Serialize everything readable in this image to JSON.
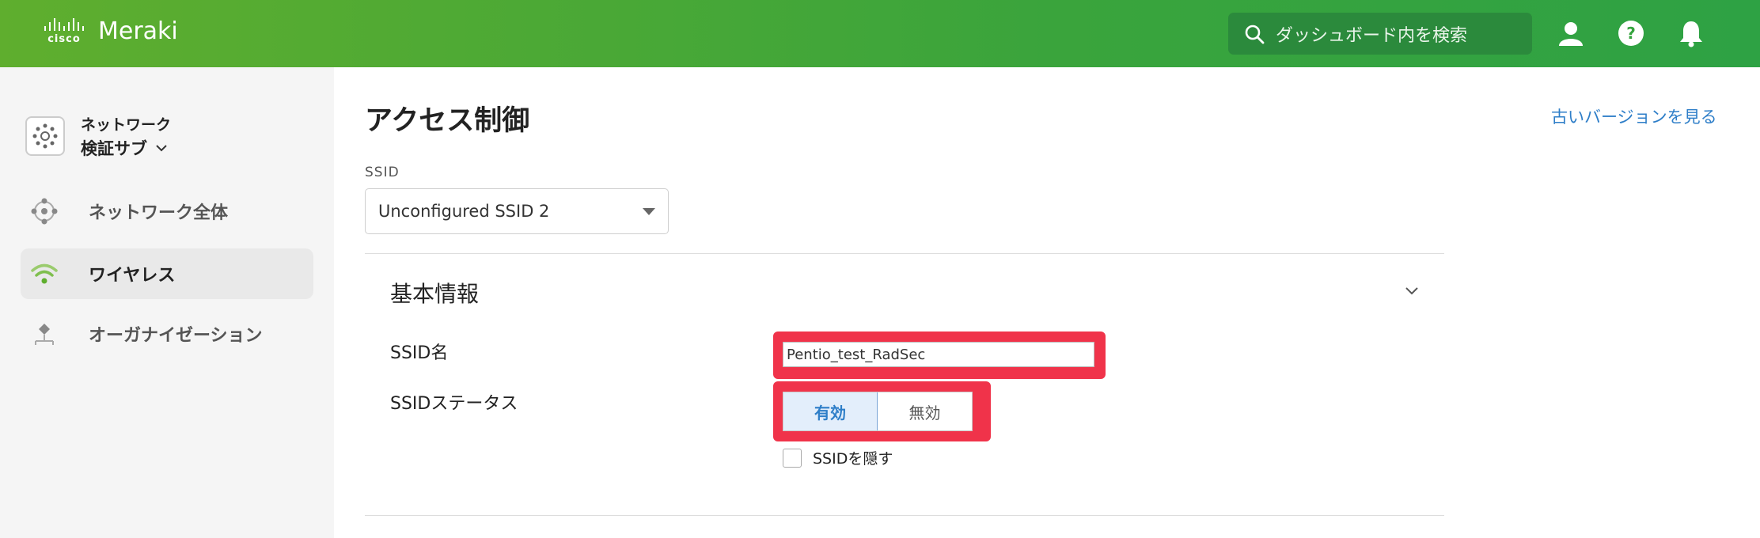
{
  "header": {
    "brand_small": "cisco",
    "brand": "Meraki",
    "search_placeholder": "ダッシュボード内を検索",
    "icons": [
      "user-icon",
      "help-icon",
      "bell-icon"
    ]
  },
  "sidebar": {
    "network_heading": "ネットワーク",
    "network_name": "検証サブ",
    "items": [
      {
        "label": "ネットワーク全体",
        "icon": "network-wide-icon",
        "active": false
      },
      {
        "label": "ワイヤレス",
        "icon": "wifi-icon",
        "active": true
      },
      {
        "label": "オーガナイゼーション",
        "icon": "organization-icon",
        "active": false
      }
    ]
  },
  "main": {
    "title": "アクセス制御",
    "old_version_link": "古いバージョンを見る",
    "ssid_label": "SSID",
    "ssid_selected": "Unconfigured SSID 2",
    "section_title": "基本情報",
    "ssid_name_label": "SSID名",
    "ssid_name_value": "Pentio_test_RadSec",
    "ssid_status_label": "SSIDステータス",
    "status_enabled": "有効",
    "status_disabled": "無効",
    "hide_ssid_label": "SSIDを隠す"
  },
  "colors": {
    "header_green": "#3aa43c",
    "link_blue": "#2e7ec8",
    "highlight_red": "#f0334a"
  }
}
